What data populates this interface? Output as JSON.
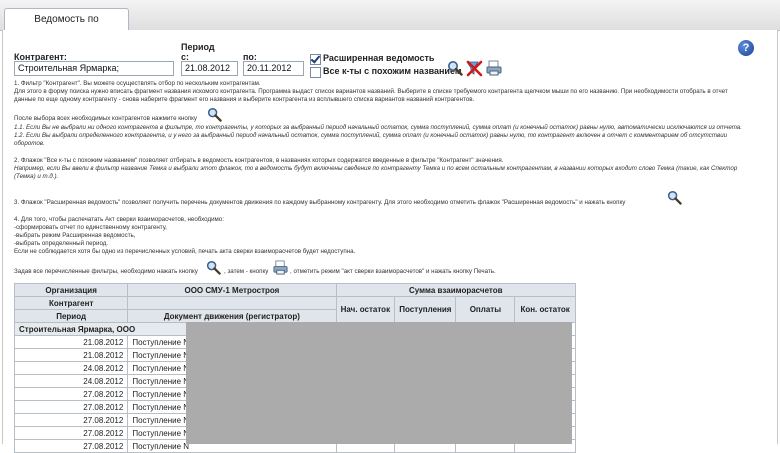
{
  "tab": {
    "title": "Ведомость по контрагентам"
  },
  "filters": {
    "contractor_label": "Контрагент:",
    "contractor_value": "Строительная Ярмарка;",
    "period_label": "Период",
    "from_label": "с:",
    "from_value": "21.08.2012",
    "to_label": "по:",
    "to_value": "20.11.2012",
    "extended_label": "Расширенная ведомость",
    "extended_checked": true,
    "similar_label": "Все к-ты с похожим названием",
    "similar_checked": false
  },
  "toolbar": {
    "icons": [
      "search-icon",
      "clear-filter-icon",
      "print-report-icon"
    ]
  },
  "instructions": [
    "1. Фильтр \"Контрагент\". Вы можете осуществлять отбор по нескольким контрагентам.",
    "Для этого в форму поиска нужно вписать фрагмент названия искомого контрагента. Программа выдаст список вариантов названий. Выберите в списке требуемого контрагента щелчком мыши по его названию. При необходимости отобрать в отчет",
    "данные по еще одному контрагенту - снова наберите фрагмент его названия и выберите контрагента из всплывшего списка вариантов названий контрагентов.",
    "После выбора всех необходимых контрагентов нажмите кнопку",
    "1.1. Если Вы не выбрали ни одного контрагента в фильтре, то контрагенты, у которых за выбранный период начальный остаток, сумма поступлений, сумма оплат (и конечный остаток) равны нулю, автоматически исключаются из отчета.",
    "1.2. Если Вы выбрали определенного контрагента, и у него за выбранный период начальный остаток, сумма поступлений, сумма оплат (и конечный остаток) равны нулю, то контрагент включен в отчет с комментарием об отсутствии",
    "оборотов.",
    "2. Флажок \"Все к-ты с похожим названием\" позволяет отбирать в ведомость контрагентов, в названиях которых содержатся введенные в фильтре \"Контрагент\" значения.",
    "Например, если Вы ввели в фильтр название Темка и выбрали этот флажок, то в ведомость будут включены сведения по контрагенту Темка и по всем остальным контрагентам, в названии которых входит слово Темка (такие, как Спектор",
    "(Темка) и т.д.).",
    "3. Флажок \"Расширенная ведомость\" позволяет получить перечень документов движения по каждому выбранному контрагенту. Для этого необходимо отметить флажок \"Расширенная ведомость\" и нажать кнопку",
    "4. Для того, чтобы распечатать Акт сверки взаиморасчетов, необходимо:",
    "-сформировать отчет по единственному контрагенту,",
    "-выбрать режим Расширенная ведомость,",
    "-выбрать определенный период.",
    "Если не соблюдается хотя бы одно из перечисленных условий, печать акта сверки взаиморасчетов будет недоступна.",
    "Задав все перечисленные фильтры, необходимо нажать кнопку",
    ", затем - кнопку",
    ", отметить режим \"акт сверки взаиморасчетов\" и нажать кнопку Печать."
  ],
  "table": {
    "h_org": "Организация",
    "h_org_value": "ООО СМУ-1 Метростроя",
    "h_sum": "Сумма взаиморасчетов",
    "h_contractor": "Контрагент",
    "h_period": "Период",
    "h_doc": "Документ движения (регистратор)",
    "h_start": "Нач. остаток",
    "h_income": "Поступления",
    "h_payments": "Оплаты",
    "h_end": "Кон. остаток",
    "group": "Строительная Ярмарка, ООО",
    "rows": [
      {
        "date": "21.08.2012",
        "doc": "Поступление N"
      },
      {
        "date": "21.08.2012",
        "doc": "Поступление N"
      },
      {
        "date": "24.08.2012",
        "doc": "Поступление N"
      },
      {
        "date": "24.08.2012",
        "doc": "Поступление N"
      },
      {
        "date": "27.08.2012",
        "doc": "Поступление N"
      },
      {
        "date": "27.08.2012",
        "doc": "Поступление N"
      },
      {
        "date": "27.08.2012",
        "doc": "Поступление N"
      },
      {
        "date": "27.08.2012",
        "doc": "Поступление N"
      },
      {
        "date": "27.08.2012",
        "doc": "Поступление N"
      }
    ]
  }
}
